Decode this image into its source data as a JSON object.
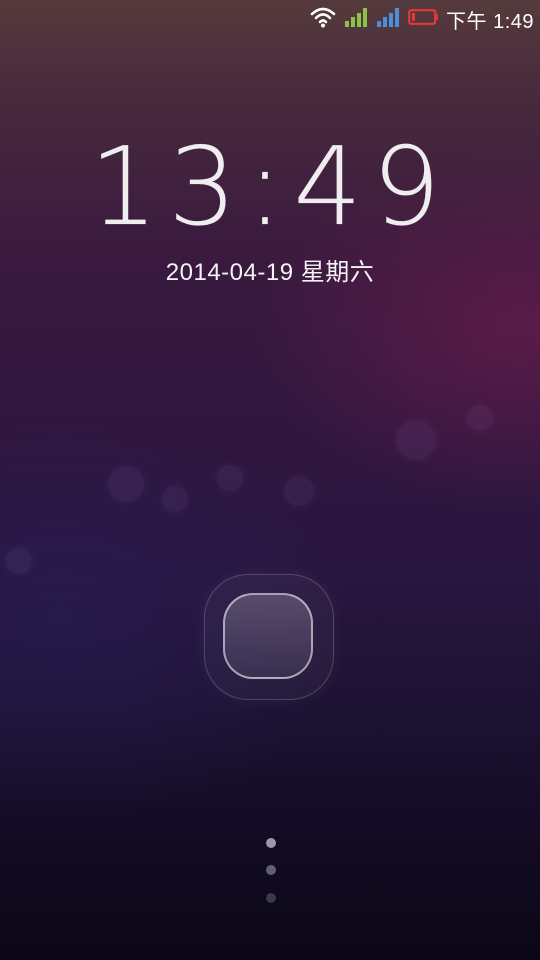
{
  "status_bar": {
    "time": "下午 1:49",
    "icons": [
      "wifi-icon",
      "signal-icon",
      "signal-icon",
      "battery-icon"
    ],
    "colors": {
      "signal_1": "#8bc34a",
      "signal_2": "#4a8fd9",
      "battery": "#e53935"
    }
  },
  "lockscreen": {
    "clock": "13:49",
    "date": "2014-04-19 星期六",
    "unlock_icon": "unlock-button",
    "page_dots": 3
  }
}
